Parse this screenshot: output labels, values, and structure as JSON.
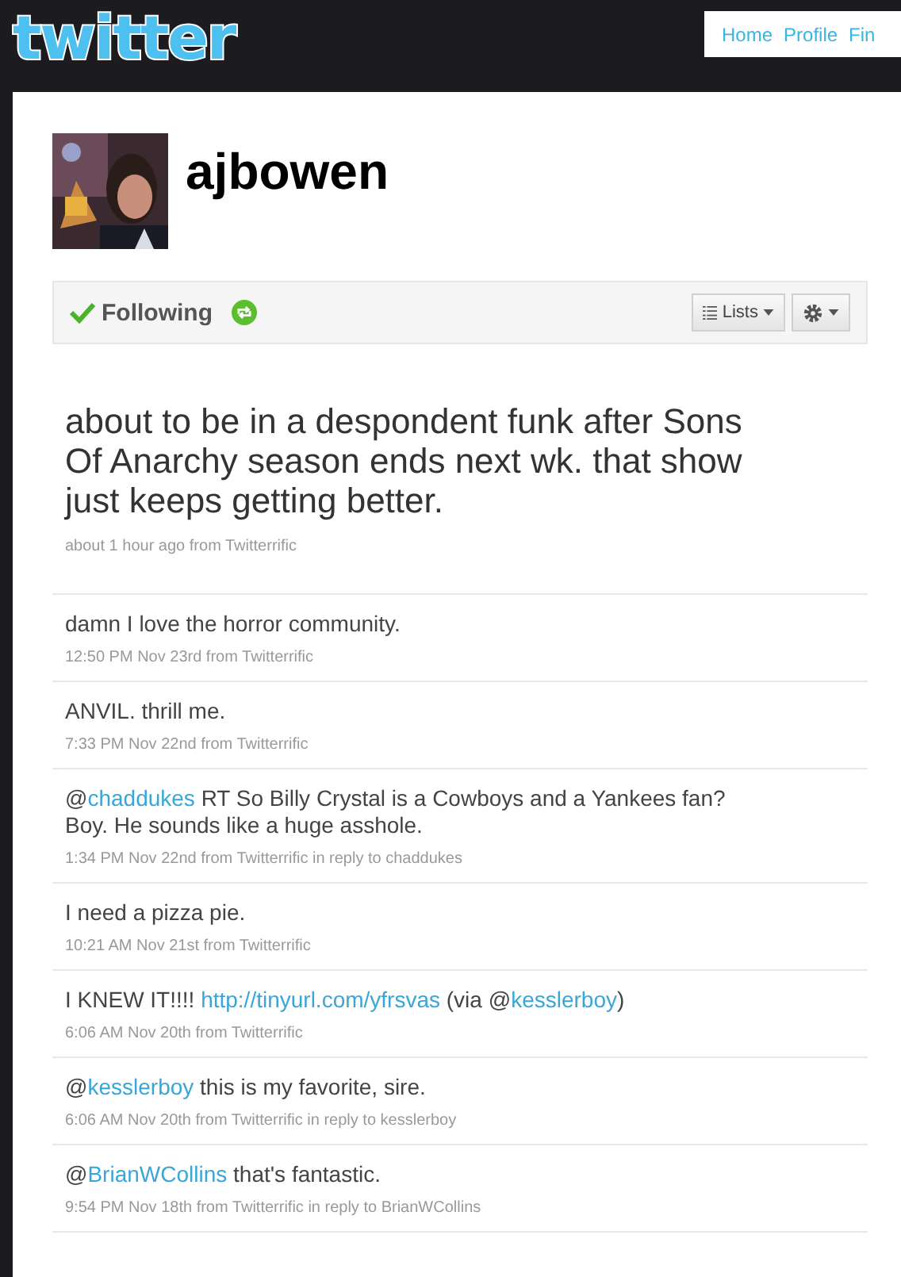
{
  "header": {
    "logo": "twitter",
    "nav": [
      {
        "label": "Home"
      },
      {
        "label": "Profile"
      },
      {
        "label": "Fin"
      }
    ]
  },
  "profile": {
    "screen_name": "ajbowen"
  },
  "actions": {
    "following": "Following",
    "lists": "Lists"
  },
  "featured": {
    "parts": [
      {
        "kind": "plain",
        "text": "about to be in a despondent funk after Sons Of Anarchy season ends next wk. that show just keeps getting better."
      }
    ],
    "meta": "about 1 hour ago from Twitterrific"
  },
  "tweets": [
    {
      "parts": [
        {
          "kind": "plain",
          "text": "damn I love the horror community."
        }
      ],
      "meta": "12:50 PM Nov 23rd from Twitterrific"
    },
    {
      "parts": [
        {
          "kind": "plain",
          "text": "ANVIL. thrill me."
        }
      ],
      "meta": "7:33 PM Nov 22nd from Twitterrific"
    },
    {
      "parts": [
        {
          "kind": "plain",
          "text": "@"
        },
        {
          "kind": "link",
          "text": "chaddukes"
        },
        {
          "kind": "plain",
          "text": " RT So Billy Crystal is a Cowboys and a Yankees fan? Boy. He sounds like a huge asshole."
        }
      ],
      "meta": "1:34 PM Nov 22nd from Twitterrific in reply to chaddukes"
    },
    {
      "parts": [
        {
          "kind": "plain",
          "text": "I need a pizza pie."
        }
      ],
      "meta": "10:21 AM Nov 21st from Twitterrific"
    },
    {
      "parts": [
        {
          "kind": "plain",
          "text": "I KNEW IT!!!! "
        },
        {
          "kind": "link",
          "text": "http://tinyurl.com/yfrsvas"
        },
        {
          "kind": "plain",
          "text": " (via @"
        },
        {
          "kind": "link",
          "text": "kesslerboy"
        },
        {
          "kind": "plain",
          "text": ")"
        }
      ],
      "meta": "6:06 AM Nov 20th from Twitterrific"
    },
    {
      "parts": [
        {
          "kind": "plain",
          "text": "@"
        },
        {
          "kind": "link",
          "text": "kesslerboy"
        },
        {
          "kind": "plain",
          "text": " this is my favorite, sire."
        }
      ],
      "meta": "6:06 AM Nov 20th from Twitterrific in reply to kesslerboy"
    },
    {
      "parts": [
        {
          "kind": "plain",
          "text": "@"
        },
        {
          "kind": "link",
          "text": "BrianWCollins"
        },
        {
          "kind": "plain",
          "text": " that's fantastic."
        }
      ],
      "meta": "9:54 PM Nov 18th from Twitterrific in reply to BrianWCollins"
    }
  ]
}
